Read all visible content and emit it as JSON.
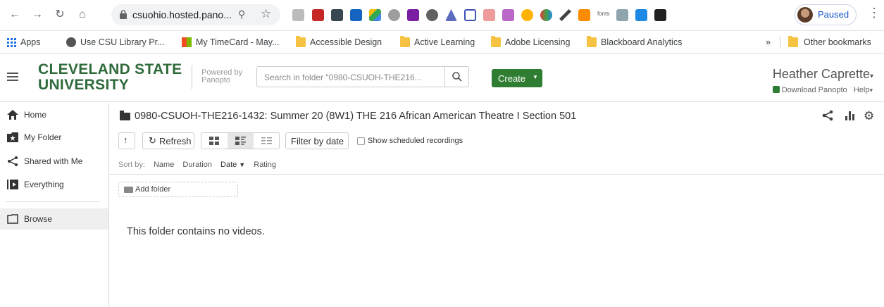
{
  "browser": {
    "url": "csuohio.hosted.pano...",
    "profile_status": "Paused",
    "ext_fonts_label": "fonts"
  },
  "bookmarks": {
    "apps": "Apps",
    "items": [
      "Use CSU Library Pr...",
      "My TimeCard - May...",
      "Accessible Design",
      "Active Learning",
      "Adobe Licensing",
      "Blackboard Analytics"
    ],
    "overflow": "»",
    "other": "Other bookmarks"
  },
  "header": {
    "logo_line1": "CLEVELAND STATE",
    "logo_line2": "UNIVERSITY",
    "powered_by": "Powered by",
    "powered_brand": "Panopto",
    "search_placeholder": "Search in folder \"0980-CSUOH-THE216...",
    "create_label": "Create",
    "user_name": "Heather Caprette",
    "download_label": "Download Panopto",
    "help_label": "Help"
  },
  "sidebar": {
    "items": [
      {
        "label": "Home",
        "icon": "home-icon"
      },
      {
        "label": "My Folder",
        "icon": "star-folder-icon"
      },
      {
        "label": "Shared with Me",
        "icon": "share-icon"
      },
      {
        "label": "Everything",
        "icon": "play-stack-icon"
      }
    ],
    "browse": "Browse"
  },
  "main": {
    "folder_title": "0980-CSUOH-THE216-1432: Summer 20 (8W1) THE 216 African American Theatre I Section 501",
    "refresh_label": "Refresh",
    "filter_label": "Filter by date",
    "show_scheduled_label": "Show scheduled recordings",
    "sort_by_label": "Sort by:",
    "sort_options": [
      "Name",
      "Duration",
      "Date",
      "Rating"
    ],
    "active_sort": "Date",
    "add_folder_label": "Add folder",
    "empty_message": "This folder contains no videos."
  },
  "colors": {
    "brand_green": "#2e6a3a",
    "create_green": "#2e7d32",
    "profile_blue": "#1a57c9"
  }
}
